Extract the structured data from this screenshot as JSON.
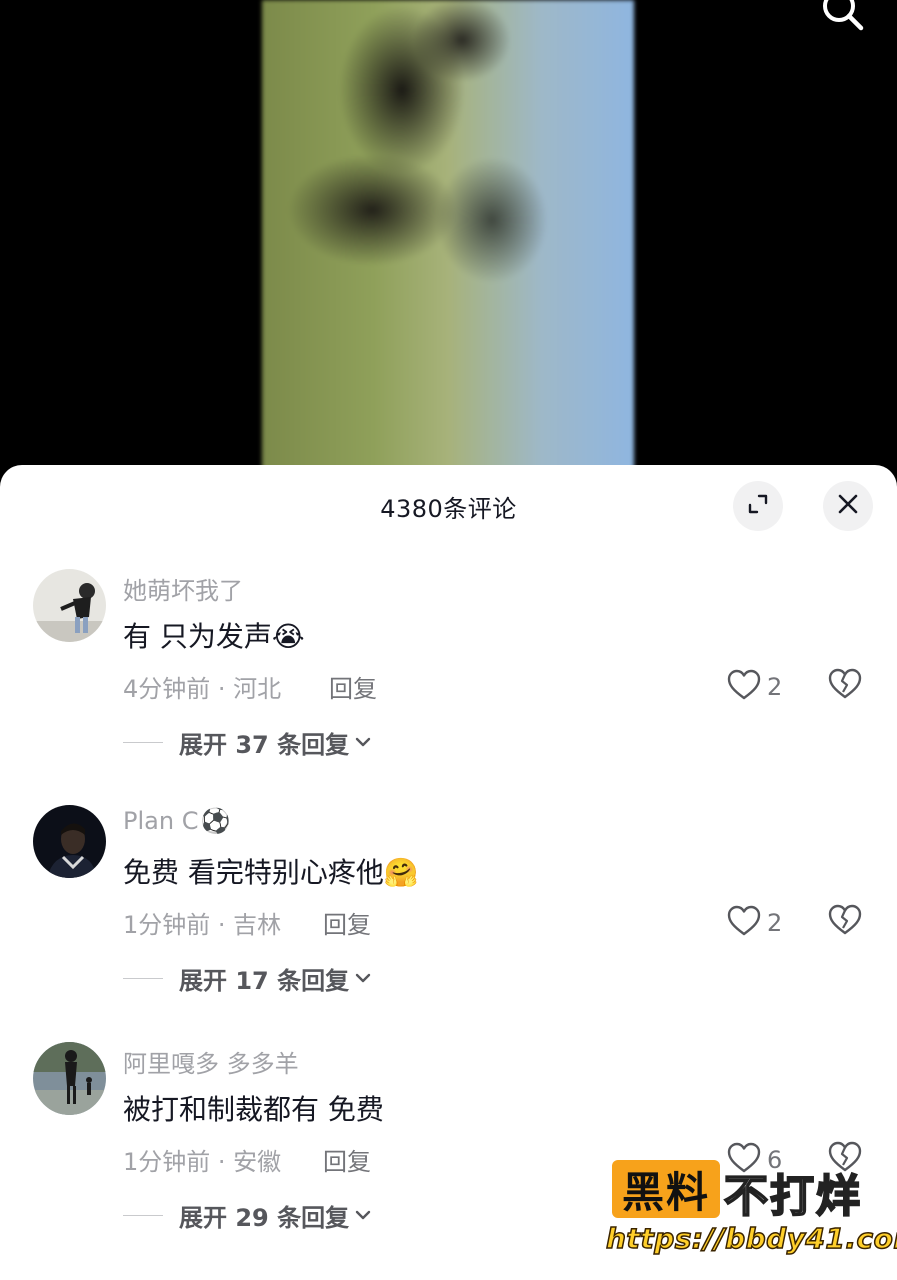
{
  "sheet": {
    "title": "4380条评论"
  },
  "comments": [
    {
      "user": "她萌坏我了",
      "text": "有 只为发声",
      "emoji": "😭",
      "meta": "4分钟前 · 河北",
      "reply_label": "回复",
      "likes": "2",
      "expand": "展开 37 条回复"
    },
    {
      "user": "Plan C",
      "user_emoji": "⚽",
      "text": "免费 看完特别心疼他",
      "emoji": "🤗",
      "meta": "1分钟前 · 吉林",
      "reply_label": "回复",
      "likes": "2",
      "expand": "展开 17 条回复"
    },
    {
      "user": "阿里嘎多 多多羊",
      "text": "被打和制裁都有 免费",
      "meta": "1分钟前 · 安徽",
      "reply_label": "回复",
      "likes": "6",
      "expand": "展开 29 条回复"
    }
  ],
  "watermark": {
    "brand_a": "黑料",
    "brand_b": "不打烊",
    "url": "https://bbdy41.com"
  },
  "icons": {
    "search": "search-icon",
    "expand": "expand-icon",
    "close": "close-icon",
    "like": "heart-icon",
    "dislike": "broken-heart-icon",
    "chevron": "chevron-down-icon"
  },
  "colors": {
    "primary_text": "#161823",
    "secondary_text": "#a1a2a7",
    "watermark_orange": "#f7a21b"
  }
}
